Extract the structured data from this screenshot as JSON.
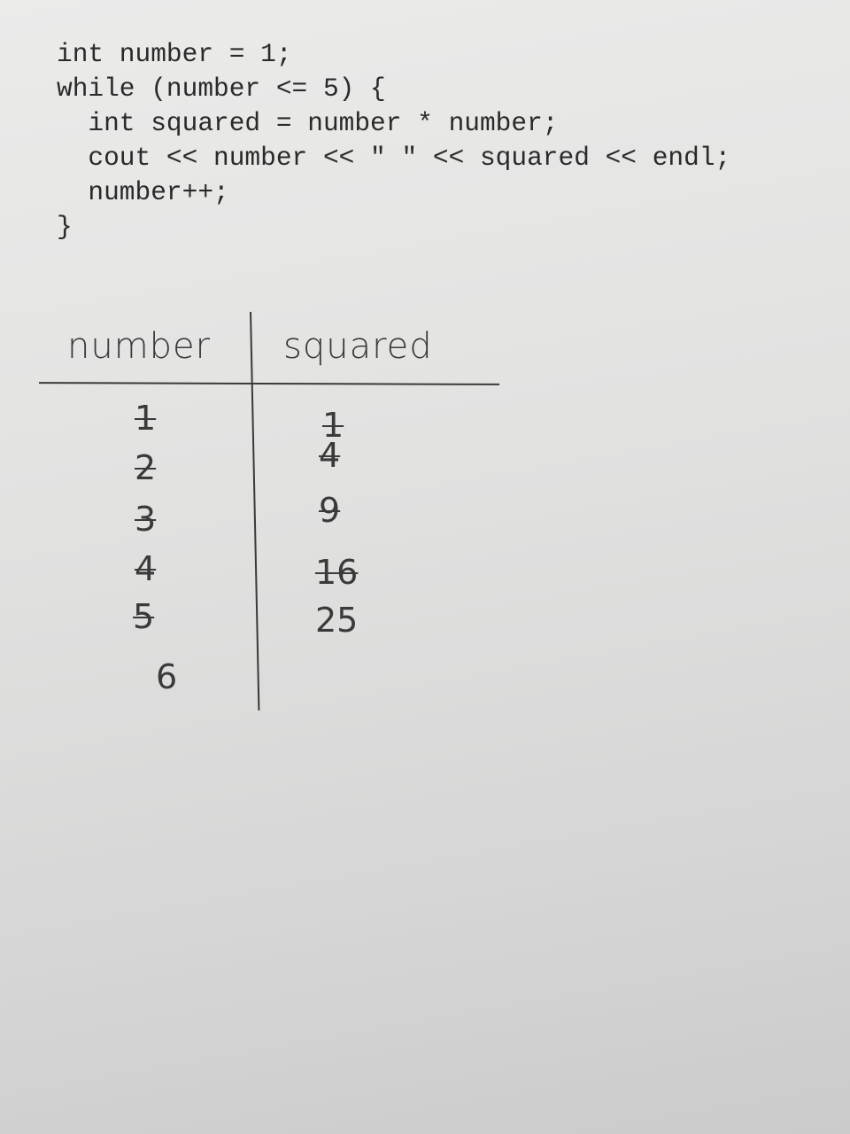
{
  "code": {
    "lines": [
      "int number = 1;",
      "while (number <= 5) {",
      "  int squared = number * number;",
      "  cout << number << \" \" << squared << endl;",
      "  number++;",
      "}"
    ]
  },
  "trace_table": {
    "headers": [
      "number",
      "squared"
    ],
    "number_column": [
      {
        "value": "1",
        "crossed_out": true
      },
      {
        "value": "2",
        "crossed_out": true
      },
      {
        "value": "3",
        "crossed_out": true
      },
      {
        "value": "4",
        "crossed_out": true
      },
      {
        "value": "5",
        "crossed_out": true
      },
      {
        "value": "6",
        "crossed_out": false
      }
    ],
    "squared_column": [
      {
        "value": "1",
        "crossed_out": true
      },
      {
        "value": "4",
        "crossed_out": true
      },
      {
        "value": "9",
        "crossed_out": true
      },
      {
        "value": "16",
        "crossed_out": true
      },
      {
        "value": "25",
        "crossed_out": false
      }
    ]
  }
}
